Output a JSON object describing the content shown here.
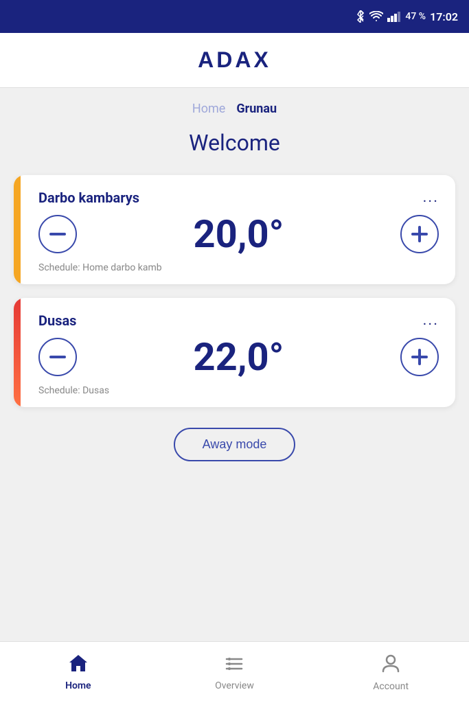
{
  "statusBar": {
    "battery": "47 %",
    "time": "17:02",
    "icons": [
      "bluetooth",
      "wifi",
      "signal",
      "battery"
    ]
  },
  "header": {
    "logo": "ADAX"
  },
  "breadcrumb": {
    "items": [
      {
        "label": "Home",
        "active": false
      },
      {
        "label": "Grunau",
        "active": true
      }
    ]
  },
  "welcome": {
    "title": "Welcome"
  },
  "cards": [
    {
      "id": "card-1",
      "name": "Darbo kambarys",
      "temperature": "20,0°",
      "schedule": "Schedule: Home darbo kamb",
      "accent": "yellow",
      "menuLabel": "..."
    },
    {
      "id": "card-2",
      "name": "Dusas",
      "temperature": "22,0°",
      "schedule": "Schedule: Dusas",
      "accent": "orange-red",
      "menuLabel": "..."
    }
  ],
  "awayButton": {
    "label": "Away mode"
  },
  "bottomNav": {
    "items": [
      {
        "id": "home",
        "label": "Home",
        "active": true
      },
      {
        "id": "overview",
        "label": "Overview",
        "active": false
      },
      {
        "id": "account",
        "label": "Account",
        "active": false
      }
    ]
  }
}
